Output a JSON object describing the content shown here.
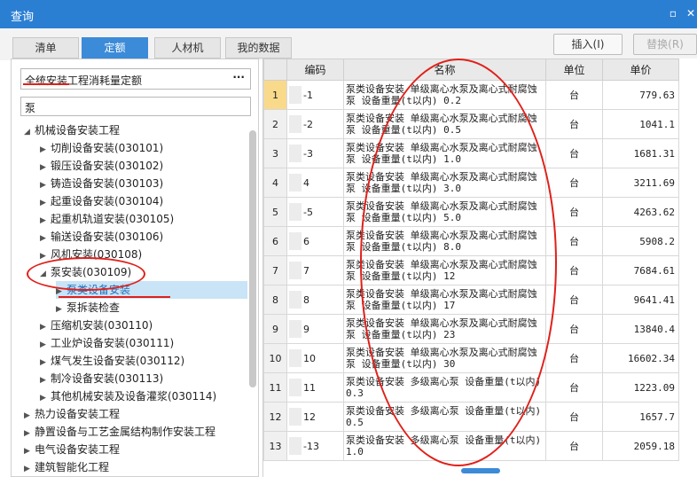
{
  "window": {
    "title": "查询",
    "minimize_glyph": "▫",
    "close_glyph": "✕"
  },
  "tabs": [
    {
      "label": "清单",
      "active": false
    },
    {
      "label": "定额",
      "active": true
    },
    {
      "label": "人材机",
      "active": false
    },
    {
      "label": "我的数据",
      "active": false
    }
  ],
  "toolbar": {
    "insert_label": "插入(I)",
    "replace_label": "替换(R)"
  },
  "left": {
    "library_value": "全统安装工程消耗量定额",
    "library_more": "···",
    "search_value": "泵"
  },
  "tree": [
    {
      "label": "机械设备安装工程",
      "level": 0,
      "expanded": true
    },
    {
      "label": "切削设备安装(030101)",
      "level": 1,
      "expanded": false
    },
    {
      "label": "锻压设备安装(030102)",
      "level": 1,
      "expanded": false
    },
    {
      "label": "铸造设备安装(030103)",
      "level": 1,
      "expanded": false
    },
    {
      "label": "起重设备安装(030104)",
      "level": 1,
      "expanded": false
    },
    {
      "label": "起重机轨道安装(030105)",
      "level": 1,
      "expanded": false
    },
    {
      "label": "输送设备安装(030106)",
      "level": 1,
      "expanded": false
    },
    {
      "label": "风机安装(030108)",
      "level": 1,
      "expanded": false
    },
    {
      "label": "泵安装(030109)",
      "level": 1,
      "expanded": true
    },
    {
      "label": "泵类设备安装",
      "level": 2,
      "expanded": false,
      "selected": true
    },
    {
      "label": "泵拆装检查",
      "level": 2,
      "expanded": false
    },
    {
      "label": "压缩机安装(030110)",
      "level": 1,
      "expanded": false
    },
    {
      "label": "工业炉设备安装(030111)",
      "level": 1,
      "expanded": false
    },
    {
      "label": "煤气发生设备安装(030112)",
      "level": 1,
      "expanded": false
    },
    {
      "label": "制冷设备安装(030113)",
      "level": 1,
      "expanded": false
    },
    {
      "label": "其他机械安装及设备灌浆(030114)",
      "level": 1,
      "expanded": false
    },
    {
      "label": "热力设备安装工程",
      "level": 0,
      "expanded": false
    },
    {
      "label": "静置设备与工艺金属结构制作安装工程",
      "level": 0,
      "expanded": false
    },
    {
      "label": "电气设备安装工程",
      "level": 0,
      "expanded": false
    },
    {
      "label": "建筑智能化工程",
      "level": 0,
      "expanded": false
    }
  ],
  "table": {
    "headers": [
      "",
      "编码",
      "名称",
      "单位",
      "单价"
    ],
    "rows": [
      {
        "n": "1",
        "code": "-1",
        "name": "泵类设备安装 单级离心水泵及离心式耐腐蚀泵 设备重量(t以内) 0.2",
        "unit": "台",
        "price": "779.63"
      },
      {
        "n": "2",
        "code": "-2",
        "name": "泵类设备安装 单级离心水泵及离心式耐腐蚀泵 设备重量(t以内) 0.5",
        "unit": "台",
        "price": "1041.1"
      },
      {
        "n": "3",
        "code": "-3",
        "name": "泵类设备安装 单级离心水泵及离心式耐腐蚀泵 设备重量(t以内) 1.0",
        "unit": "台",
        "price": "1681.31"
      },
      {
        "n": "4",
        "code": "4",
        "name": "泵类设备安装 单级离心水泵及离心式耐腐蚀泵 设备重量(t以内) 3.0",
        "unit": "台",
        "price": "3211.69"
      },
      {
        "n": "5",
        "code": "-5",
        "name": "泵类设备安装 单级离心水泵及离心式耐腐蚀泵 设备重量(t以内) 5.0",
        "unit": "台",
        "price": "4263.62"
      },
      {
        "n": "6",
        "code": "6",
        "name": "泵类设备安装 单级离心水泵及离心式耐腐蚀泵 设备重量(t以内) 8.0",
        "unit": "台",
        "price": "5908.2"
      },
      {
        "n": "7",
        "code": "7",
        "name": "泵类设备安装 单级离心水泵及离心式耐腐蚀泵 设备重量(t以内) 12",
        "unit": "台",
        "price": "7684.61"
      },
      {
        "n": "8",
        "code": "8",
        "name": "泵类设备安装 单级离心水泵及离心式耐腐蚀泵 设备重量(t以内) 17",
        "unit": "台",
        "price": "9641.41"
      },
      {
        "n": "9",
        "code": "9",
        "name": "泵类设备安装 单级离心水泵及离心式耐腐蚀泵 设备重量(t以内) 23",
        "unit": "台",
        "price": "13840.4"
      },
      {
        "n": "10",
        "code": "10",
        "name": "泵类设备安装 单级离心水泵及离心式耐腐蚀泵 设备重量(t以内) 30",
        "unit": "台",
        "price": "16602.34"
      },
      {
        "n": "11",
        "code": "11",
        "name": "泵类设备安装 多级离心泵 设备重量(t以内) 0.3",
        "unit": "台",
        "price": "1223.09"
      },
      {
        "n": "12",
        "code": "12",
        "name": "泵类设备安装 多级离心泵 设备重量(t以内) 0.5",
        "unit": "台",
        "price": "1657.7"
      },
      {
        "n": "13",
        "code": "-13",
        "name": "泵类设备安装 多级离心泵 设备重量(t以内) 1.0",
        "unit": "台",
        "price": "2059.18"
      }
    ]
  },
  "colors": {
    "title_bar": "#2b7fd3",
    "active_tab": "#3c8bd8",
    "selection": "#c9e3f7",
    "annotation": "#e0201a",
    "row_highlight": "#f9d98a"
  }
}
